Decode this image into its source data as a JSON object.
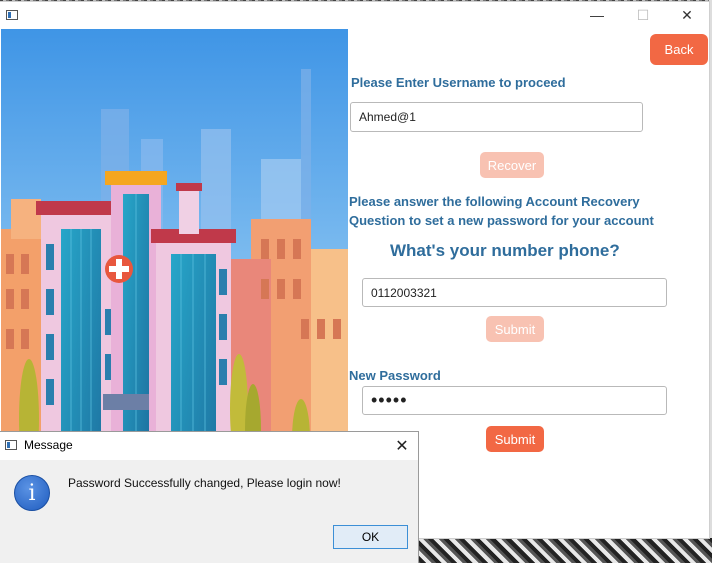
{
  "window": {
    "minimize_glyph": "—",
    "maximize_glyph": "☐",
    "close_glyph": "✕",
    "illustration": "hospital-illustration"
  },
  "form": {
    "back_label": "Back",
    "username_prompt": "Please Enter Username to proceed",
    "username_value": "Ahmed@1",
    "recover_label": "Recover",
    "recovery_line1": "Please answer the following Account Recovery",
    "recovery_line2": "Question to set a new password for your account",
    "question": "What's your number phone?",
    "answer_value": "0112003321",
    "submit_answer_label": "Submit",
    "new_password_label": "New Password",
    "new_password_value": "•••••",
    "submit_password_label": "Submit"
  },
  "dialog": {
    "title": "Message",
    "close_glyph": "✕",
    "info_glyph": "i",
    "message": "Password Successfully changed, Please login now!",
    "ok_label": "OK"
  },
  "colors": {
    "accent": "#f26844",
    "accent_disabled": "#f8c2b2",
    "label_blue": "#2f6d9c"
  }
}
